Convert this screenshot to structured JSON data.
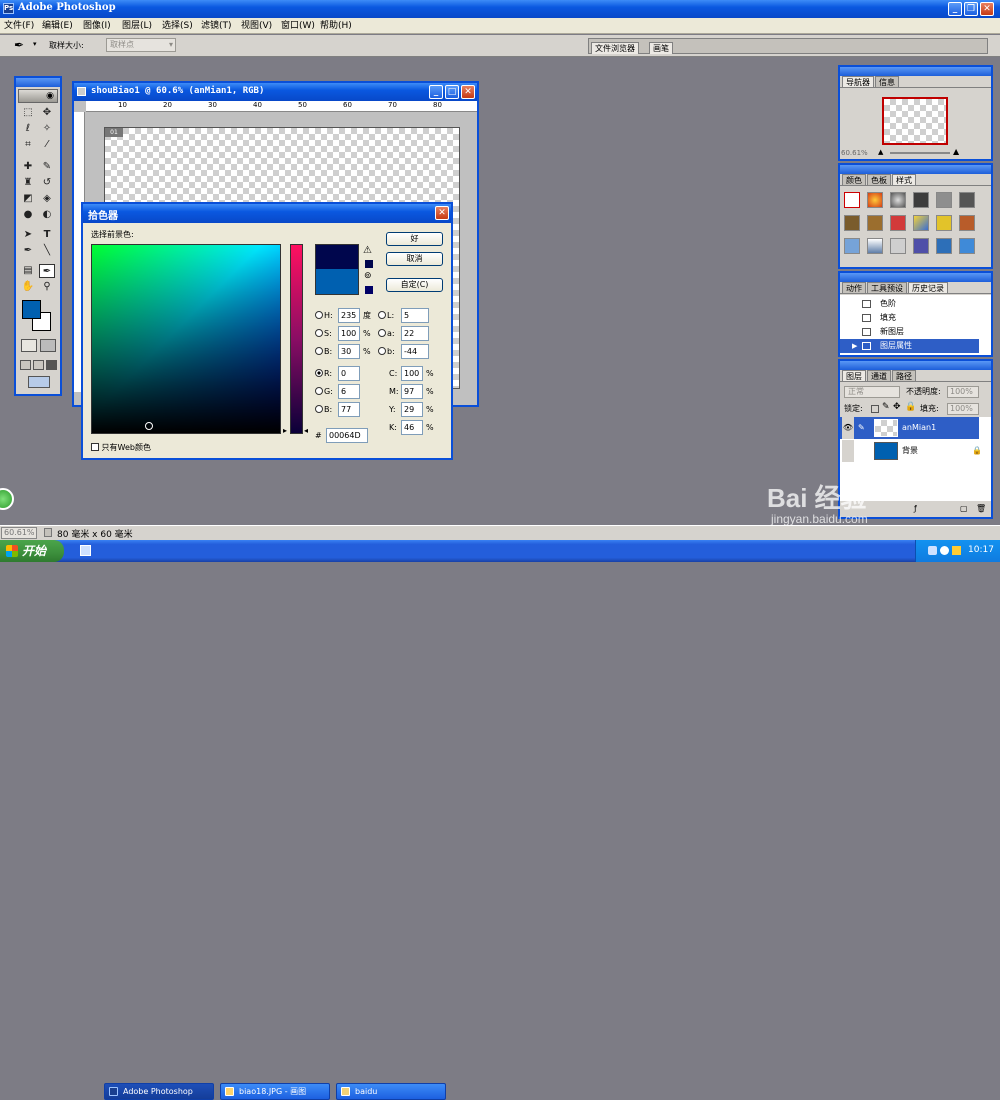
{
  "app": {
    "title": "Adobe Photoshop",
    "menu": [
      "文件(F)",
      "编辑(E)",
      "图像(I)",
      "图层(L)",
      "选择(S)",
      "滤镜(T)",
      "视图(V)",
      "窗口(W)",
      "帮助(H)"
    ]
  },
  "options_bar": {
    "sample_size_label": "取样大小:",
    "sample_size_value": "取样点",
    "well_tabs": [
      "文件浏览器",
      "画笔"
    ]
  },
  "document": {
    "title": "shouBiao1 @ 60.6% (anMian1, RGB)",
    "ruler_labels": [
      "10",
      "20",
      "30",
      "40",
      "50",
      "60",
      "70",
      "80"
    ]
  },
  "color_picker": {
    "title": "拾色器",
    "prompt": "选择前景色:",
    "ok_label": "好",
    "cancel_label": "取消",
    "custom_label": "自定(C)",
    "web_only_label": "只有Web颜色",
    "fields": {
      "H": "235",
      "S": "100",
      "B": "30",
      "R": "0",
      "G": "6",
      "B2": "77",
      "L": "5",
      "a": "22",
      "b": "-44",
      "C": "100",
      "M": "97",
      "Y": "29",
      "K": "46",
      "hex": "00064D"
    },
    "labels": {
      "H": "H:",
      "S": "S:",
      "B": "B:",
      "R": "R:",
      "G": "G:",
      "B2": "B:",
      "L": "L:",
      "a": "a:",
      "b": "b:",
      "C": "C:",
      "M": "M:",
      "Y": "Y:",
      "K": "K:",
      "hash": "#"
    },
    "units": {
      "degree": "度",
      "percent": "%"
    },
    "new_color": "#00064D",
    "old_color": "#0060b0"
  },
  "navigator": {
    "tabs": [
      "导航器",
      "信息"
    ],
    "zoom": "60.61%"
  },
  "color_panel": {
    "tabs": [
      "颜色",
      "色板",
      "样式"
    ]
  },
  "history_panel": {
    "tabs": [
      "动作",
      "工具预设",
      "历史记录"
    ],
    "items": [
      "色阶",
      "填充",
      "新图层",
      "图层属性"
    ]
  },
  "layers_panel": {
    "tabs": [
      "图层",
      "通道",
      "路径"
    ],
    "blend_mode": "正常",
    "opacity_label": "不透明度:",
    "opacity_value": "100%",
    "lock_label": "锁定:",
    "fill_label": "填充:",
    "fill_value": "100%",
    "layers": [
      {
        "name": "anMian1"
      },
      {
        "name": "背景"
      }
    ]
  },
  "status_bar": {
    "zoom": "60.61%",
    "doc_info": "80 毫米 x 60 毫米"
  },
  "taskbar": {
    "start_label": "开始",
    "items": [
      "Adobe Photoshop",
      "biao18.JPG - 画图",
      "baidu"
    ],
    "clock": "10:17"
  },
  "watermark": {
    "brand": "Bai 经验",
    "url": "jingyan.baidu.com"
  },
  "colors": {
    "xp_blue": "#0a58e0",
    "ps_gray": "#7d7c85",
    "foreground": "#0060b0"
  }
}
